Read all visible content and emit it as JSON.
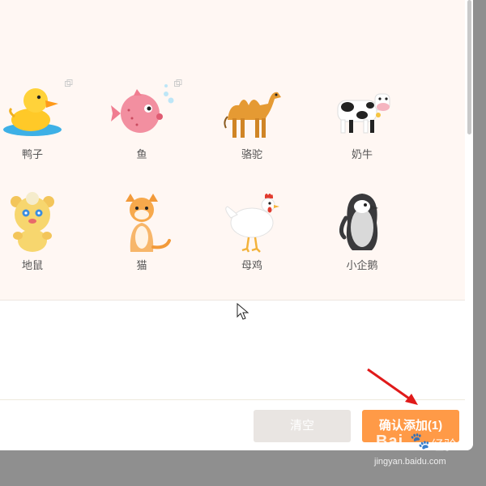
{
  "grid": {
    "items": [
      {
        "label": "鸭子",
        "icon": "duck-icon",
        "pinned": true
      },
      {
        "label": "鱼",
        "icon": "pufferfish-icon",
        "pinned": true
      },
      {
        "label": "骆驼",
        "icon": "camel-icon",
        "pinned": false
      },
      {
        "label": "奶牛",
        "icon": "cow-icon",
        "pinned": false
      },
      {
        "label": "地鼠",
        "icon": "gopher-icon",
        "pinned": false
      },
      {
        "label": "猫",
        "icon": "cat-icon",
        "pinned": false
      },
      {
        "label": "母鸡",
        "icon": "hen-icon",
        "pinned": false
      },
      {
        "label": "小企鹅",
        "icon": "penguin-icon",
        "pinned": false
      }
    ]
  },
  "footer": {
    "clear_label": "清空",
    "confirm_label": "确认添加(1)"
  },
  "watermark": {
    "logo": "Bai",
    "paw": "🐾",
    "brand": "经验",
    "url": "jingyan.baidu.com"
  },
  "colors": {
    "accent": "#ff9a47",
    "grid_bg": "#fff7f3",
    "clear_button": "#e9e5e2"
  }
}
